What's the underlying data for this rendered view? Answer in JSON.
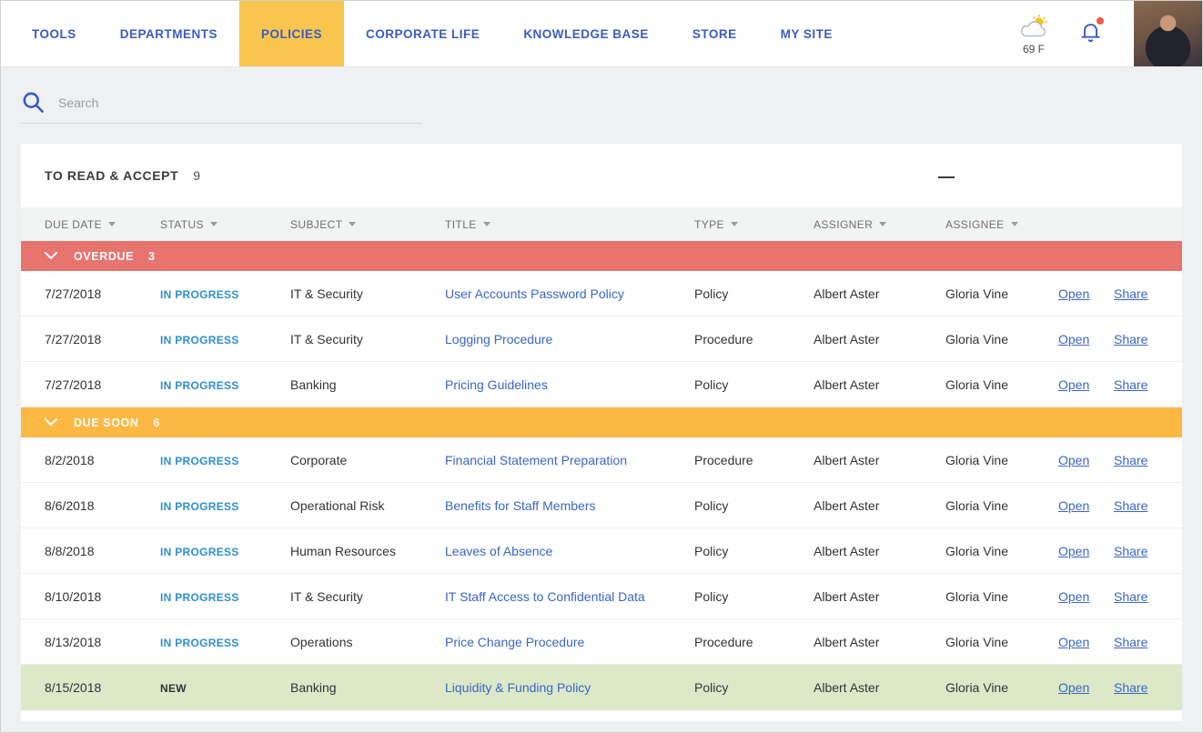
{
  "colors": {
    "nav_blue": "#3a5bc5",
    "active_tab_yellow": "#f8c64e",
    "link_blue": "#3a66c4",
    "status_in_progress_blue": "#2e8fd0",
    "overdue_red": "#e87470",
    "due_soon_yellow": "#fbb843",
    "highlight_row_green": "#dce9c9",
    "notification_dot_red": "#e8584a"
  },
  "nav": {
    "items": [
      {
        "label": "TOOLS",
        "active": false
      },
      {
        "label": "DEPARTMENTS",
        "active": false
      },
      {
        "label": "POLICIES",
        "active": true
      },
      {
        "label": "CORPORATE LIFE",
        "active": false
      },
      {
        "label": "KNOWLEDGE BASE",
        "active": false
      },
      {
        "label": "STORE",
        "active": false
      },
      {
        "label": "MY SITE",
        "active": false
      }
    ],
    "weather_temp": "69 F",
    "icons": [
      "partly-cloudy-icon",
      "bell-icon",
      "user-avatar"
    ]
  },
  "search": {
    "placeholder": "Search"
  },
  "panel": {
    "title": "TO READ & ACCEPT",
    "count": "9"
  },
  "table": {
    "columns": [
      "DUE DATE",
      "STATUS",
      "SUBJECT",
      "TITLE",
      "TYPE",
      "ASSIGNER",
      "ASSIGNEE"
    ],
    "actions": {
      "open": "Open",
      "share": "Share"
    },
    "groups": [
      {
        "label": "OVERDUE",
        "count": "3",
        "color": "#e87470",
        "rows": [
          {
            "due_date": "7/27/2018",
            "status": "IN PROGRESS",
            "subject": "IT & Security",
            "title": "User Accounts Password Policy",
            "type": "Policy",
            "assigner": "Albert Aster",
            "assignee": "Gloria Vine",
            "highlighted": false
          },
          {
            "due_date": "7/27/2018",
            "status": "IN PROGRESS",
            "subject": "IT & Security",
            "title": "Logging Procedure",
            "type": "Procedure",
            "assigner": "Albert Aster",
            "assignee": "Gloria Vine",
            "highlighted": false
          },
          {
            "due_date": "7/27/2018",
            "status": "IN PROGRESS",
            "subject": "Banking",
            "title": "Pricing Guidelines",
            "type": "Policy",
            "assigner": "Albert Aster",
            "assignee": "Gloria Vine",
            "highlighted": false
          }
        ]
      },
      {
        "label": "DUE SOON",
        "count": "6",
        "color": "#fbb843",
        "rows": [
          {
            "due_date": "8/2/2018",
            "status": "IN PROGRESS",
            "subject": "Corporate",
            "title": "Financial Statement Preparation",
            "type": "Procedure",
            "assigner": "Albert Aster",
            "assignee": "Gloria Vine",
            "highlighted": false
          },
          {
            "due_date": "8/6/2018",
            "status": "IN PROGRESS",
            "subject": "Operational Risk",
            "title": "Benefits for Staff Members",
            "type": "Policy",
            "assigner": "Albert Aster",
            "assignee": "Gloria Vine",
            "highlighted": false
          },
          {
            "due_date": "8/8/2018",
            "status": "IN PROGRESS",
            "subject": "Human Resources",
            "title": "Leaves of Absence",
            "type": "Policy",
            "assigner": "Albert Aster",
            "assignee": "Gloria Vine",
            "highlighted": false
          },
          {
            "due_date": "8/10/2018",
            "status": "IN PROGRESS",
            "subject": "IT & Security",
            "title": "IT Staff Access to Confidential Data",
            "type": "Policy",
            "assigner": "Albert Aster",
            "assignee": "Gloria Vine",
            "highlighted": false
          },
          {
            "due_date": "8/13/2018",
            "status": "IN PROGRESS",
            "subject": "Operations",
            "title": "Price Change Procedure",
            "type": "Procedure",
            "assigner": "Albert Aster",
            "assignee": "Gloria Vine",
            "highlighted": false
          },
          {
            "due_date": "8/15/2018",
            "status": "NEW",
            "subject": "Banking",
            "title": "Liquidity & Funding Policy",
            "type": "Policy",
            "assigner": "Albert Aster",
            "assignee": "Gloria Vine",
            "highlighted": true
          }
        ]
      }
    ]
  }
}
